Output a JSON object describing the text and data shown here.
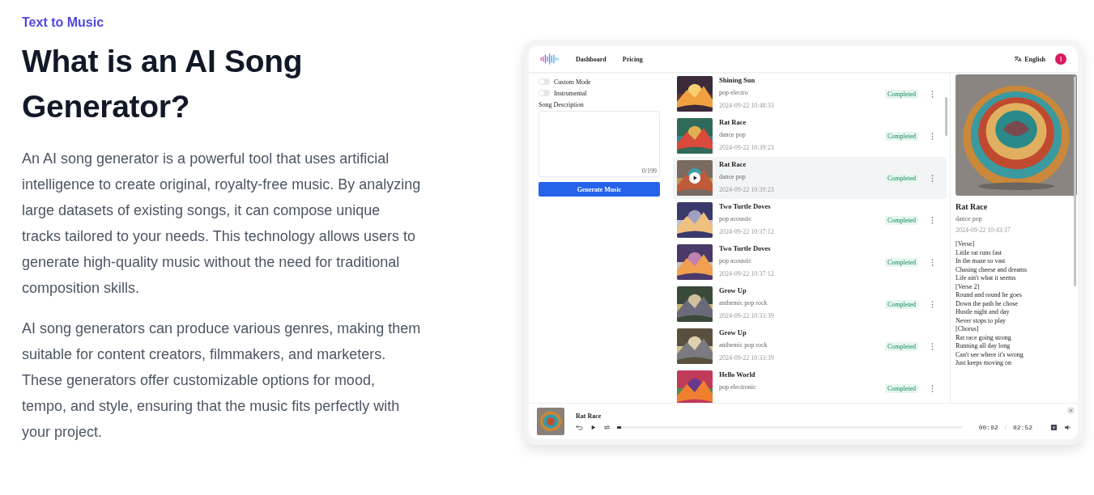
{
  "eyebrow": "Text to Music",
  "heading": "What is an AI Song Generator?",
  "paragraphs": [
    "An AI song generator is a powerful tool that uses artificial intelligence to create original, royalty-free music. By analyzing large datasets of existing songs, it can compose unique tracks tailored to your needs. This technology allows users to generate high-quality music without the need for traditional composition skills.",
    "AI song generators can produce various genres, making them suitable for content creators, filmmakers, and marketers. These generators offer customizable options for mood, tempo, and style, ensuring that the music fits perfectly with your project."
  ],
  "app": {
    "nav": [
      {
        "label": "Dashboard"
      },
      {
        "label": "Pricing"
      }
    ],
    "language": "English",
    "avatar": "I",
    "options": [
      {
        "label": "Custom Mode",
        "checked": false
      },
      {
        "label": "Instrumental",
        "checked": false
      }
    ],
    "description": {
      "label": "Song Description",
      "counter": "0/199"
    },
    "generate_button": "Generate Music",
    "songs": [
      {
        "title": "Shining Sun",
        "genre": "pop electro",
        "date": "2024-09-22 10:48:33",
        "status": "Completed",
        "selected": false
      },
      {
        "title": "Rat Race",
        "genre": "dance pop",
        "date": "2024-09-22 10:39:23",
        "status": "Completed",
        "selected": false
      },
      {
        "title": "Rat Race",
        "genre": "dance pop",
        "date": "2024-09-22 10:39:23",
        "status": "Completed",
        "selected": true
      },
      {
        "title": "Two Turtle Doves",
        "genre": "pop acoustic",
        "date": "2024-09-22 10:37:12",
        "status": "Completed",
        "selected": false
      },
      {
        "title": "Two Turtle Doves",
        "genre": "pop acoustic",
        "date": "2024-09-22 10:37:12",
        "status": "Completed",
        "selected": false
      },
      {
        "title": "Grow Up",
        "genre": "anthemic pop rock",
        "date": "2024-09-22 10:33:39",
        "status": "Completed",
        "selected": false
      },
      {
        "title": "Grow Up",
        "genre": "anthemic pop rock",
        "date": "2024-09-22 10:33:39",
        "status": "Completed",
        "selected": false
      },
      {
        "title": "Hello World",
        "genre": "pop electronic",
        "status": "Completed",
        "selected": false
      }
    ],
    "detail": {
      "title": "Rat Race",
      "genre": "dance pop",
      "date": "2024-09-22 10:43:37",
      "lyrics": [
        "[Verse]",
        "Little rat runs fast",
        "In the maze so vast",
        "Chasing cheese and dreams",
        "Life ain't what it seems",
        "[Verse 2]",
        "Round and round he goes",
        "Down the path he chose",
        "Hustle night and day",
        "Never stops to play",
        "[Chorus]",
        "Rat race going strong",
        "Running all day long",
        "Can't see where it's wrong",
        "Just keeps moving on"
      ]
    },
    "player": {
      "title": "Rat Race",
      "elapsed": "00:02",
      "separator": "/",
      "duration": "02:52",
      "level": 0.012
    }
  }
}
